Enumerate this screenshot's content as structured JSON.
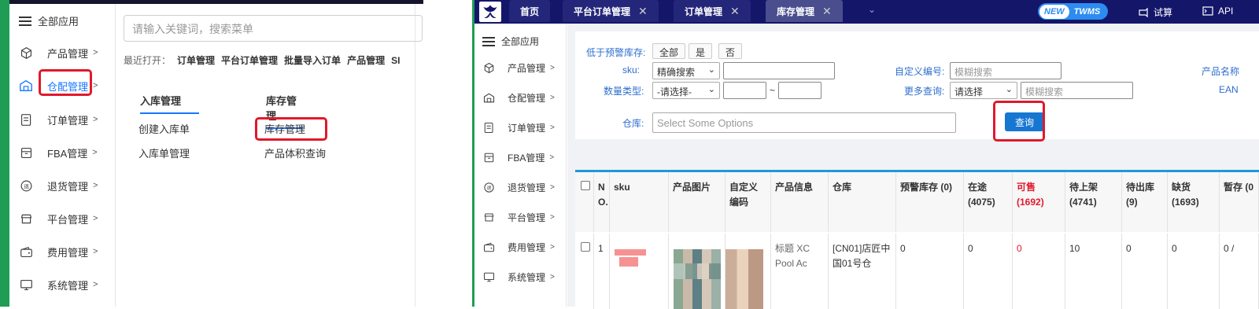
{
  "left_panel": {
    "all_apps": "全部应用",
    "nav": [
      {
        "icon": "cube-icon",
        "label": "产品管理"
      },
      {
        "icon": "warehouse-icon",
        "label": "仓配管理"
      },
      {
        "icon": "order-icon",
        "label": "订单管理"
      },
      {
        "icon": "box-icon",
        "label": "FBA管理"
      },
      {
        "icon": "return-icon",
        "label": "退货管理"
      },
      {
        "icon": "store-icon",
        "label": "平台管理"
      },
      {
        "icon": "wallet-icon",
        "label": "费用管理"
      },
      {
        "icon": "monitor-icon",
        "label": "系统管理"
      }
    ],
    "search_placeholder": "请输入关键词，搜索菜单",
    "recent_label": "最近打开：",
    "recent": [
      "订单管理",
      "平台订单管理",
      "批量导入订单",
      "产品管理",
      "SI"
    ],
    "col1": {
      "title": "入库管理",
      "links": [
        "创建入库单",
        "入库单管理"
      ]
    },
    "col2": {
      "title": "库存管理",
      "links": [
        "库存管理",
        "产品体积查询"
      ]
    }
  },
  "right_panel": {
    "tabs": [
      {
        "label": "首页",
        "closable": false
      },
      {
        "label": "平台订单管理",
        "closable": true
      },
      {
        "label": "订单管理",
        "closable": true
      },
      {
        "label": "库存管理",
        "closable": true
      }
    ],
    "close_glyph": "✕",
    "more_glyph": "⌄",
    "new_badge": "NEW",
    "twms_badge": "TWMS",
    "trial": "试算",
    "api": "API",
    "all_apps": "全部应用",
    "nav": [
      {
        "icon": "cube-icon",
        "label": "产品管理"
      },
      {
        "icon": "warehouse-icon",
        "label": "仓配管理"
      },
      {
        "icon": "order-icon",
        "label": "订单管理"
      },
      {
        "icon": "box-icon",
        "label": "FBA管理"
      },
      {
        "icon": "return-icon",
        "label": "退货管理"
      },
      {
        "icon": "store-icon",
        "label": "平台管理"
      },
      {
        "icon": "wallet-icon",
        "label": "费用管理"
      },
      {
        "icon": "monitor-icon",
        "label": "系统管理"
      }
    ],
    "filter": {
      "low_stock_label": "低于预警库存:",
      "low_stock_options": [
        "全部",
        "是",
        "否"
      ],
      "sku_label": "sku:",
      "sku_mode": "精确搜索",
      "qty_type_label": "数量类型:",
      "qty_type_value": "-请选择-",
      "range_sep": "~",
      "warehouse_label": "仓库:",
      "warehouse_placeholder": "Select Some Options",
      "custom_code_label": "自定义编号:",
      "custom_code_placeholder": "模糊搜索",
      "more_query_label": "更多查询:",
      "more_query_value": "请选择",
      "more_query_placeholder": "模糊搜索",
      "product_name_label": "产品名称",
      "ean_label": "EAN",
      "query_button": "查询"
    },
    "table": {
      "headers": [
        "N O.",
        "sku",
        "产品图片",
        "自定义编码",
        "产品信息",
        "仓库",
        "预警库存 (0)",
        "在途 (4075)",
        "可售 (1692)",
        "待上架 (4741)",
        "待出库 (9)",
        "缺货 (1693)",
        "暂存 (0"
      ],
      "row": {
        "no": "1",
        "product_info": "标题 XC Pool Ac",
        "warehouse": "[CN01]店匠中国01号仓",
        "warning": "0",
        "in_transit": "0",
        "sellable": "0",
        "to_shelf": "10",
        "to_ship": "0",
        "short": "0",
        "staging": "0 /"
      }
    }
  }
}
